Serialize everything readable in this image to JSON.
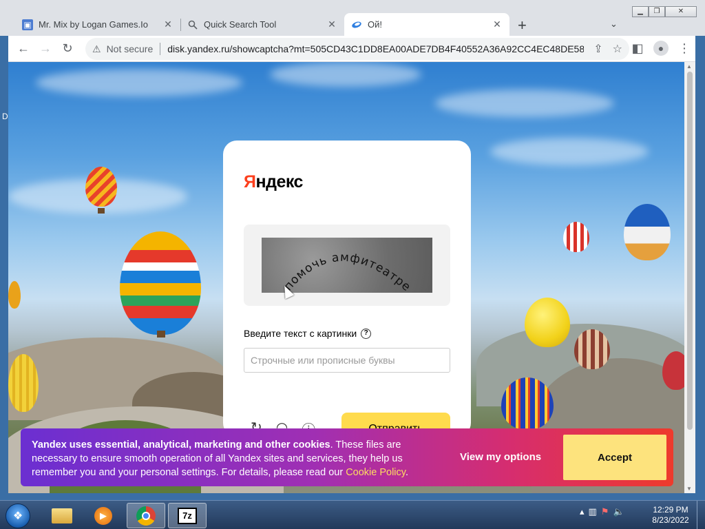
{
  "browser": {
    "tabs": [
      {
        "title": "Mr. Mix by Logan Games.Io",
        "icon": "game-icon",
        "active": false
      },
      {
        "title": "Quick Search Tool",
        "icon": "search-icon",
        "active": false
      },
      {
        "title": "Ой!",
        "icon": "yandex-disk-icon",
        "active": true
      }
    ],
    "address": {
      "security_label": "Not secure",
      "url": "disk.yandex.ru/showcaptcha?mt=505CD43C1DD8EA00ADE7DB4F40552A36A92CC4EC48DE58..."
    }
  },
  "captcha_page": {
    "logo_prefix": "Я",
    "logo_rest": "ндекс",
    "captcha_text": "помочь амфитеатре",
    "input_label": "Введите текст с картинки",
    "input_placeholder": "Строчные или прописные буквы",
    "submit_label": "Отправить"
  },
  "cookie_banner": {
    "bold_text": "Yandex uses essential, analytical, marketing and other cookies",
    "body_text": ". These files are necessary to ensure smooth operation of all Yandex sites and services, they help us remember you and your personal settings. For details, please read our ",
    "link_text": "Cookie Policy",
    "end_text": ".",
    "options_label": "View my options",
    "accept_label": "Accept"
  },
  "taskbar": {
    "apps": [
      "explorer",
      "media-player",
      "chrome",
      "7zip"
    ],
    "time": "12:29 PM",
    "date": "8/23/2022"
  },
  "desktop": {
    "edge_letter": "D"
  }
}
